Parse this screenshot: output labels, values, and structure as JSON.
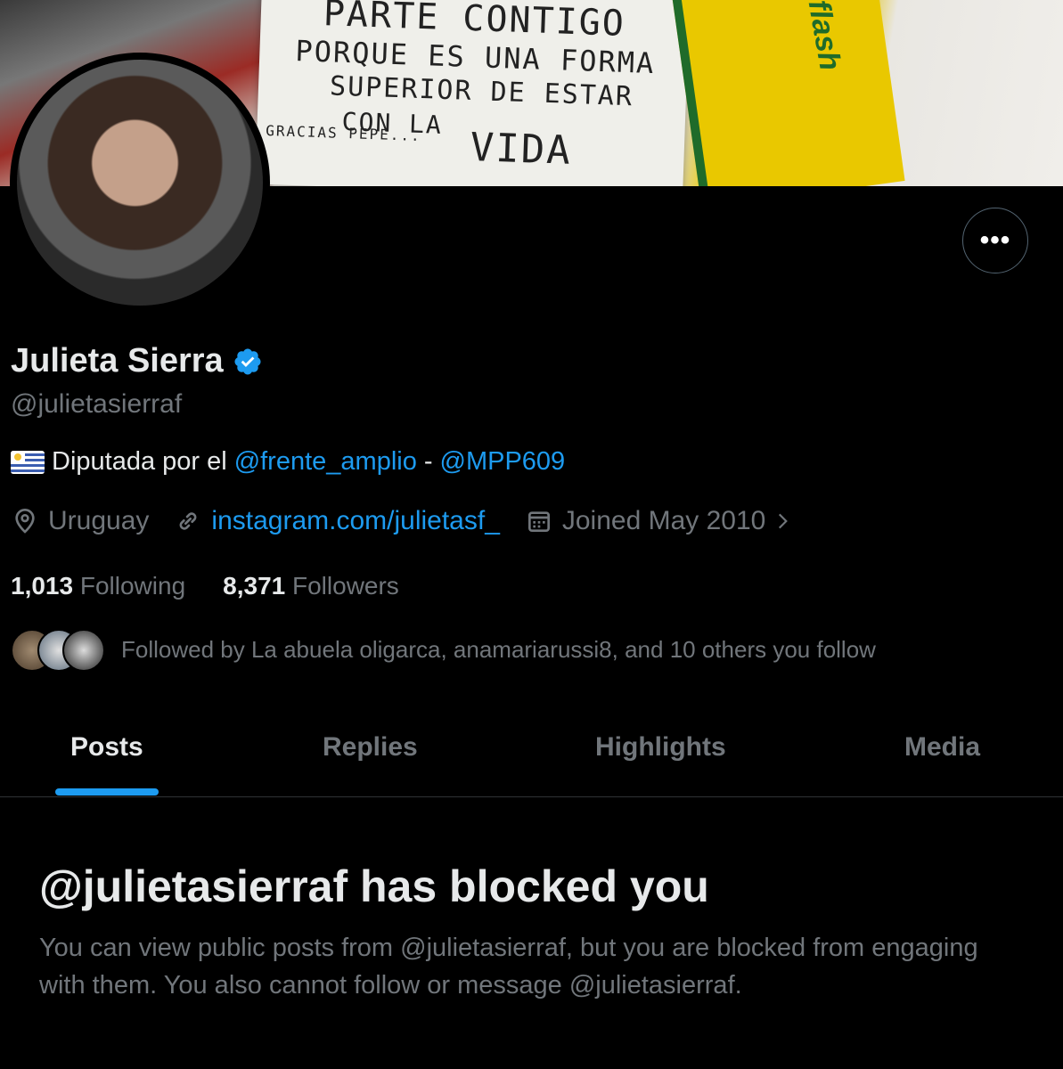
{
  "banner": {
    "note_lines": [
      "PARTE CONTIGO",
      "PORQUE ES UNA FORMA",
      "SUPERIOR DE ESTAR",
      "CON LA",
      "VIDA",
      "GRACIAS PEPE..."
    ],
    "shirt_text": "flash"
  },
  "profile": {
    "display_name": "Julieta Sierra",
    "handle": "@julietasierraf",
    "verified": true,
    "bio": {
      "flag_icon": "uruguay-flag-icon",
      "text": "Diputada por el",
      "mention1": "@frente_amplio",
      "separator": "-",
      "mention2": "@MPP609"
    },
    "location": "Uruguay",
    "website": "instagram.com/julietasf_",
    "joined": "Joined May 2010",
    "following_count": "1,013",
    "following_label": "Following",
    "followers_count": "8,371",
    "followers_label": "Followers",
    "followed_by": "Followed by La abuela oligarca, anamariarussi8, and 10 others you follow"
  },
  "more_button": "•••",
  "tabs": [
    {
      "label": "Posts",
      "active": true
    },
    {
      "label": "Replies",
      "active": false
    },
    {
      "label": "Highlights",
      "active": false
    },
    {
      "label": "Media",
      "active": false
    }
  ],
  "blocked": {
    "title": "@julietasierraf has blocked you",
    "description": "You can view public posts from @julietasierraf, but you are blocked from engaging with them. You also cannot follow or message @julietasierraf."
  },
  "colors": {
    "accent": "#1d9bf0",
    "verified": "#1d9bf0",
    "secondary_text": "#71767b",
    "background": "#000000"
  }
}
